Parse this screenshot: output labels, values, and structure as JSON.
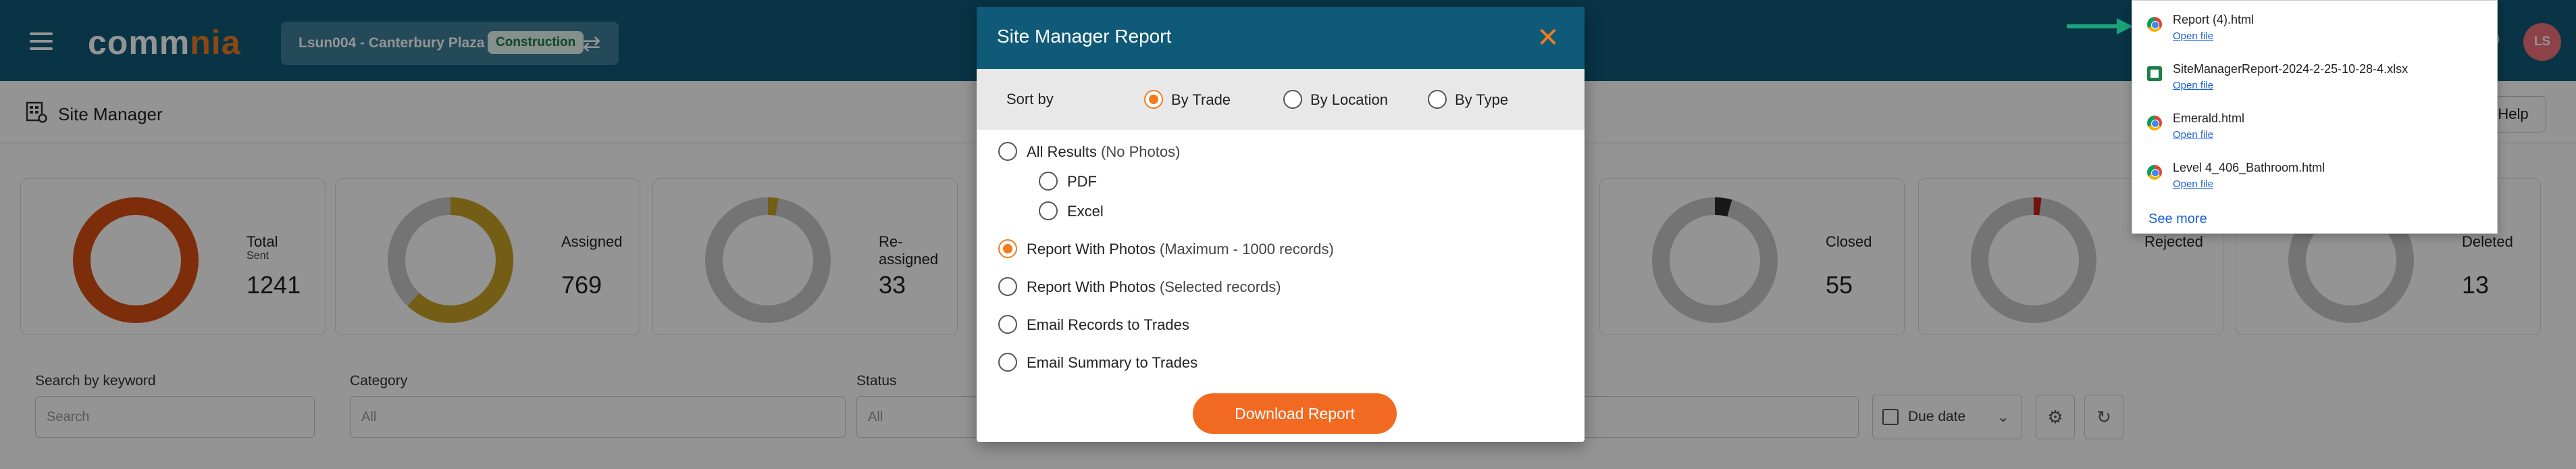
{
  "app": {
    "logo_main": "comm",
    "logo_accent": "nia"
  },
  "header": {
    "project_name": "Lsun004 - Canterbury Plaza",
    "project_tag": "Construction",
    "avatar_initials": "LS"
  },
  "page": {
    "title": "Site Manager",
    "help_label": "Help"
  },
  "stats": [
    {
      "label": "Total",
      "sub": "Sent",
      "value": "1241",
      "color": "#d94e12",
      "fraction": 1.0
    },
    {
      "label": "Assigned",
      "sub": "",
      "value": "769",
      "color": "#c9a227",
      "fraction": 0.62
    },
    {
      "label": "Re-assigned",
      "sub": "",
      "value": "33",
      "color": "#c9a227",
      "fraction": 0.027
    },
    {
      "label": "Closed",
      "sub": "",
      "value": "55",
      "color": "#2a2a2a",
      "fraction": 0.044
    },
    {
      "label": "Rejected",
      "sub": "",
      "value": "",
      "color": "#c0241b",
      "fraction": 0.02
    },
    {
      "label": "Deleted",
      "sub": "",
      "value": "13",
      "color": "#6a6a6a",
      "fraction": 0.0
    }
  ],
  "filters": {
    "search_label": "Search by keyword",
    "search_placeholder": "Search",
    "category_label": "Category",
    "category_value": "All",
    "status_label": "Status",
    "status_value": "All",
    "due_date_label": "Due date"
  },
  "modal": {
    "title": "Site Manager Report",
    "sort_label": "Sort by",
    "sort_options": [
      "By Trade",
      "By Location",
      "By Type"
    ],
    "sort_selected": "By Trade",
    "options": [
      {
        "label": "All Results",
        "note": "(No Photos)",
        "checked": false
      },
      {
        "label": "PDF",
        "note": "",
        "checked": false,
        "sub": true
      },
      {
        "label": "Excel",
        "note": "",
        "checked": false,
        "sub": true
      },
      {
        "label": "Report With Photos",
        "note": "(Maximum - 1000 records)",
        "checked": true
      },
      {
        "label": "Report With Photos",
        "note": "(Selected records)",
        "checked": false
      },
      {
        "label": "Email Records to Trades",
        "note": "",
        "checked": false
      },
      {
        "label": "Email Summary to Trades",
        "note": "",
        "checked": false
      }
    ],
    "download_label": "Download Report"
  },
  "downloads": {
    "items": [
      {
        "name": "Report (4).html",
        "link": "Open file",
        "type": "chrome"
      },
      {
        "name": "SiteManagerReport-2024-2-25-10-28-4.xlsx",
        "link": "Open file",
        "type": "sheet"
      },
      {
        "name": "Emerald.html",
        "link": "Open file",
        "type": "chrome"
      },
      {
        "name": "Level 4_406_Bathroom.html",
        "link": "Open file",
        "type": "chrome"
      }
    ],
    "see_more": "See more"
  },
  "colors": {
    "header_bg": "#0e5a78",
    "accent": "#f07c1f",
    "download_button": "#f26a22"
  }
}
